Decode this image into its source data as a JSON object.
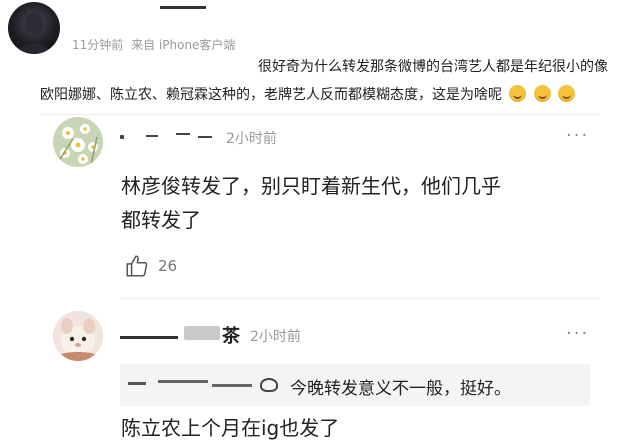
{
  "top_comment": {
    "meta_time": "11分钟前",
    "meta_source": "来自 iPhone客户端",
    "line1": "很好奇为什么转发那条微博的台湾艺人都是年纪很小的像",
    "line2": "欧阳娜娜、陈立农、赖冠霖这种的，老牌艺人反而都模糊态度，这是为啥呢",
    "emojis": [
      "laugh-emoji",
      "laugh-emoji",
      "laugh-emoji"
    ]
  },
  "comment1": {
    "time": "2小时前",
    "more": "···",
    "text_line1": "林彦俊转发了，别只盯着新生代，他们几乎",
    "text_line2": "都转发了",
    "like_count": "26"
  },
  "comment2": {
    "name_partial": "茶",
    "time": "2小时前",
    "more": "···",
    "quote": "今晚转发意义不一般，挺好。",
    "text": "陈立农上个月在ig也发了"
  },
  "colors": {
    "meta_gray": "#999999",
    "quote_bg": "#f4f4f4",
    "emoji_yellow": "#f5c23b"
  }
}
